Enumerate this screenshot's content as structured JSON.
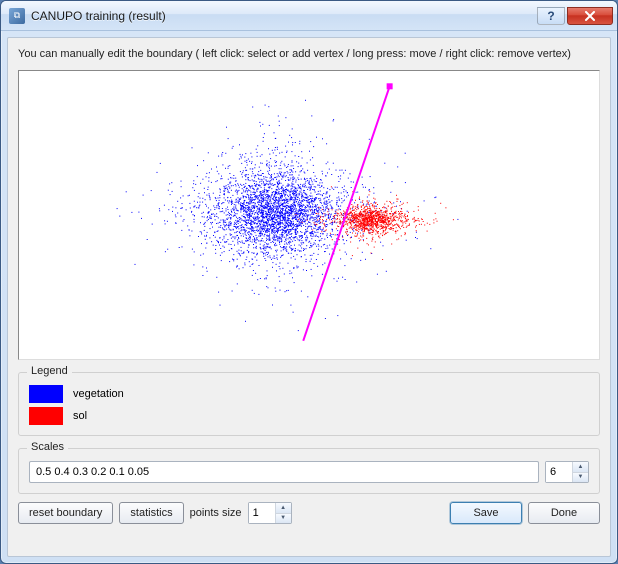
{
  "window": {
    "title": "CANUPO training (result)"
  },
  "instruction": "You can manually edit the boundary ( left click: select or add vertex / long press: move / right click: remove vertex)",
  "legend": {
    "title": "Legend",
    "items": [
      {
        "color": "#0000ff",
        "label": "vegetation"
      },
      {
        "color": "#ff0000",
        "label": "sol"
      }
    ]
  },
  "scales": {
    "title": "Scales",
    "value": "0.5 0.4 0.3 0.2 0.1 0.05",
    "count": "6"
  },
  "toolbar": {
    "reset_boundary": "reset boundary",
    "statistics": "statistics",
    "points_size_label": "points size",
    "points_size_value": "1",
    "save": "Save",
    "done": "Done"
  },
  "chart_data": {
    "type": "scatter",
    "title": "",
    "xlabel": "",
    "ylabel": "",
    "xlim": [
      -1,
      1
    ],
    "ylim": [
      -1,
      1
    ],
    "series": [
      {
        "name": "vegetation",
        "color": "#0000ff",
        "centroid": [
          -0.12,
          0.02
        ],
        "spread": [
          0.22,
          0.3
        ],
        "n_points_approx": 4000
      },
      {
        "name": "sol",
        "color": "#ff0000",
        "centroid": [
          0.22,
          -0.03
        ],
        "spread": [
          0.12,
          0.09
        ],
        "n_points_approx": 1200
      }
    ],
    "boundary": {
      "color": "#ff00ff",
      "vertices": [
        [
          0.28,
          0.9
        ],
        [
          -0.02,
          -0.88
        ]
      ]
    }
  }
}
